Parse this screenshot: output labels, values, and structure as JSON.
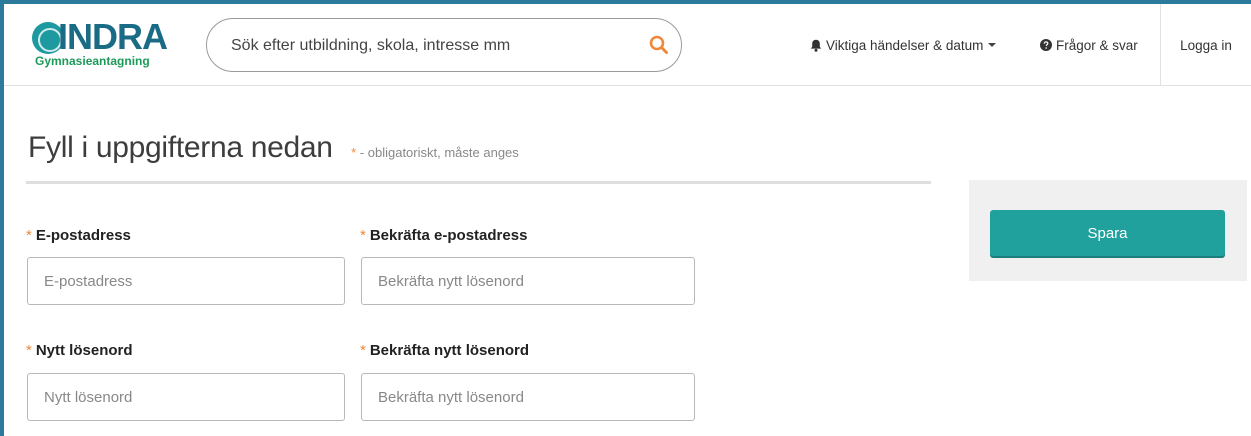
{
  "header": {
    "logo": {
      "mark": "GR",
      "word": "INDRA",
      "sub": "Gymnasieantagning"
    },
    "search": {
      "placeholder": "Sök efter utbildning, skola, intresse mm"
    },
    "nav": {
      "events": "Viktiga händelser & datum",
      "faq": "Frågor & svar",
      "login": "Logga in"
    }
  },
  "form": {
    "title": "Fyll i uppgifterna nedan",
    "required_star": "*",
    "required_note": "- obligatoriskt, måste anges",
    "fields": [
      {
        "label": "E-postadress",
        "placeholder": "E-postadress"
      },
      {
        "label": "Bekräfta e-postadress",
        "placeholder": "Bekräfta nytt lösenord"
      },
      {
        "label": "Nytt lösenord",
        "placeholder": "Nytt lösenord"
      },
      {
        "label": "Bekräfta nytt lösenord",
        "placeholder": "Bekräfta nytt lösenord"
      }
    ]
  },
  "sidebar": {
    "save_label": "Spara"
  },
  "colors": {
    "accent": "#21a19d",
    "brand": "#1a6b86",
    "required": "#f0883b",
    "frame": "#2b7a9c"
  },
  "icons": {
    "search": "search-icon",
    "events": "bell-icon",
    "faq": "question-circle-icon"
  }
}
